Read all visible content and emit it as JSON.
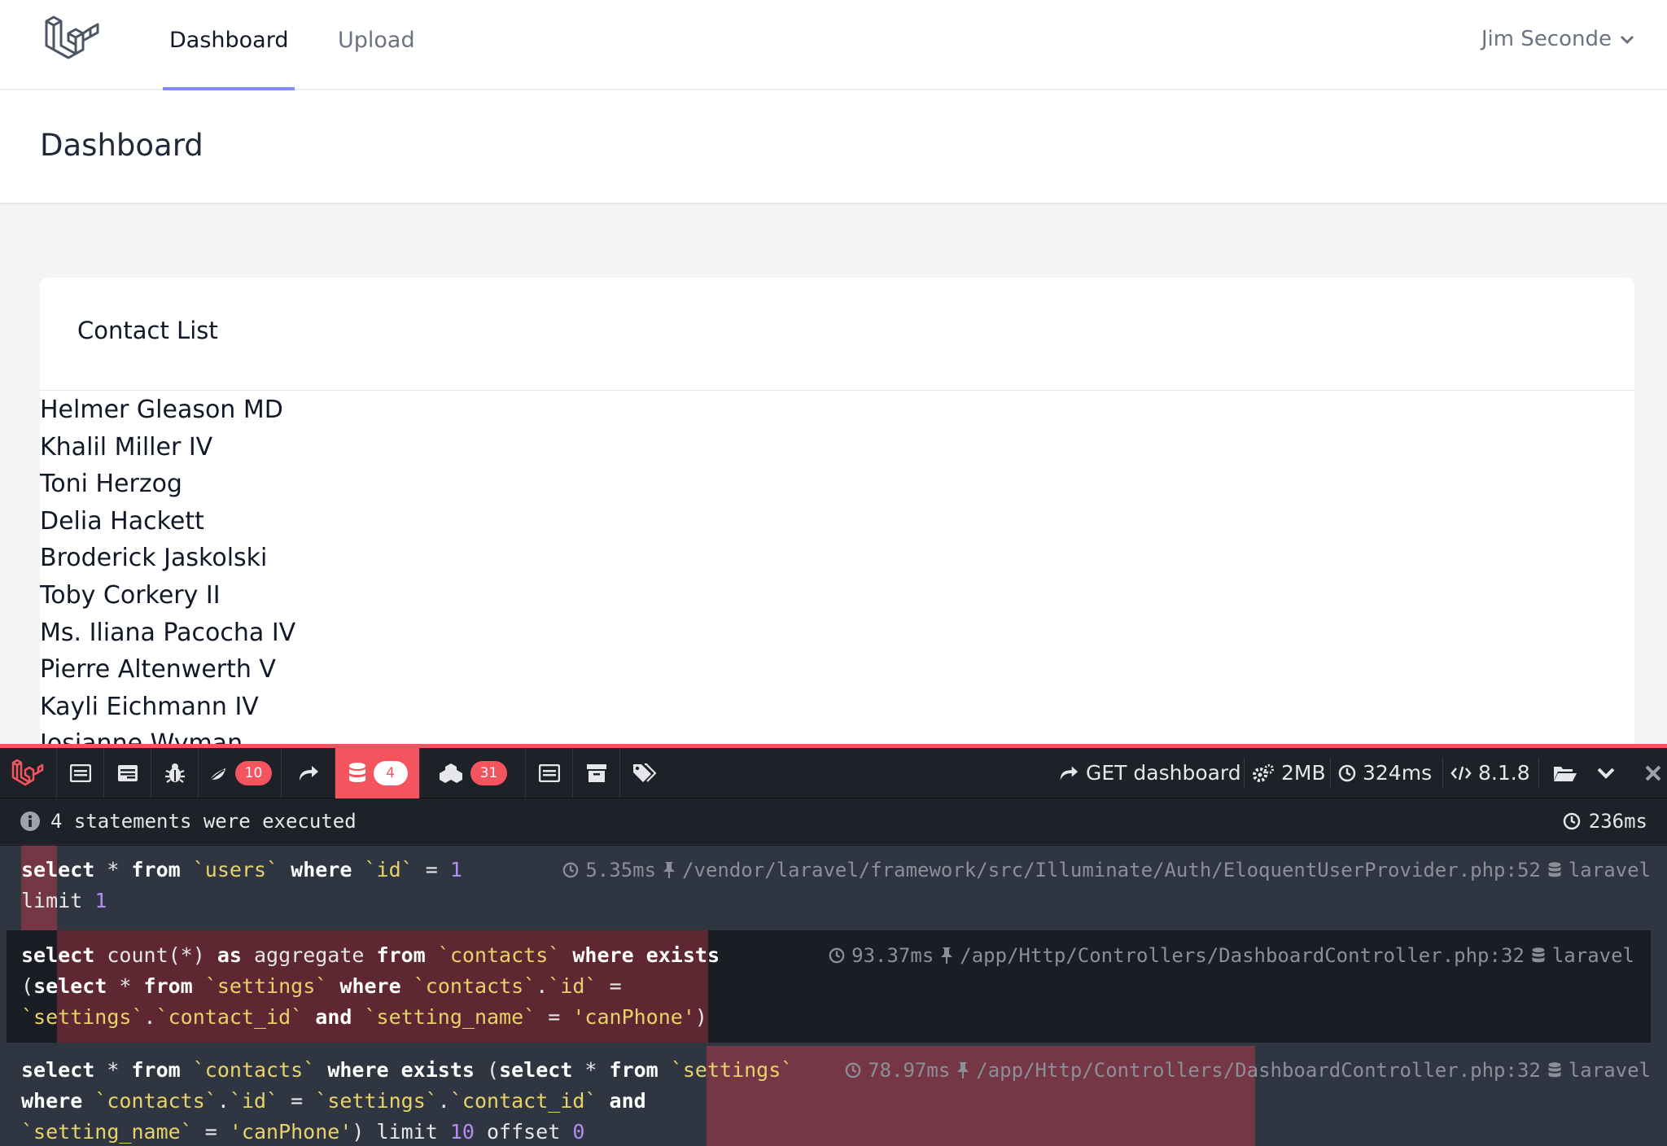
{
  "nav": {
    "links": [
      {
        "label": "Dashboard",
        "active": true
      },
      {
        "label": "Upload",
        "active": false
      }
    ],
    "user_name": "Jim Seconde"
  },
  "header": {
    "title": "Dashboard"
  },
  "card": {
    "title": "Contact List",
    "contacts": [
      "Helmer Gleason MD",
      "Khalil Miller IV",
      "Toni Herzog",
      "Delia Hackett",
      "Broderick Jaskolski",
      "Toby Corkery II",
      "Ms. Iliana Pacocha IV",
      "Pierre Altenwerth V",
      "Kayli Eichmann IV",
      "Josianne Wyman"
    ]
  },
  "debugbar": {
    "accent_color": "#f4545e",
    "tabs": [
      {
        "icon": "messages-icon"
      },
      {
        "icon": "timeline-icon"
      },
      {
        "icon": "exceptions-icon"
      },
      {
        "icon": "views-icon",
        "count": "10"
      },
      {
        "icon": "route-icon"
      },
      {
        "icon": "queries-icon",
        "count": "4",
        "active": true
      },
      {
        "icon": "models-icon",
        "count": "31"
      },
      {
        "icon": "mails-icon"
      },
      {
        "icon": "session-icon"
      },
      {
        "icon": "request-icon"
      }
    ],
    "request": "GET dashboard",
    "memory": "2MB",
    "time": "324ms",
    "php_version": "8.1.8",
    "status_text": "4 statements were executed",
    "total_time": "236ms",
    "statements": [
      {
        "sql_lines": [
          "select * from `users` where `id` = 1",
          "limit 1"
        ],
        "duration": "5.35ms",
        "source": "/vendor/laravel/framework/src/Illuminate/Auth/EloquentUserProvider.php:52",
        "connection": "laravel"
      },
      {
        "sql_lines": [
          "select count(*) as aggregate from `contacts` where exists",
          "(select * from `settings` where `contacts`.`id` =",
          "`settings`.`contact_id` and `setting_name` = 'canPhone')"
        ],
        "duration": "93.37ms",
        "source": "/app/Http/Controllers/DashboardController.php:32",
        "connection": "laravel"
      },
      {
        "sql_lines": [
          "select * from `contacts` where exists (select * from `settings`",
          "where `contacts`.`id` = `settings`.`contact_id` and",
          "`setting_name` = 'canPhone') limit 10 offset 0"
        ],
        "duration": "78.97ms",
        "source": "/app/Http/Controllers/DashboardController.php:32",
        "connection": "laravel"
      }
    ]
  }
}
